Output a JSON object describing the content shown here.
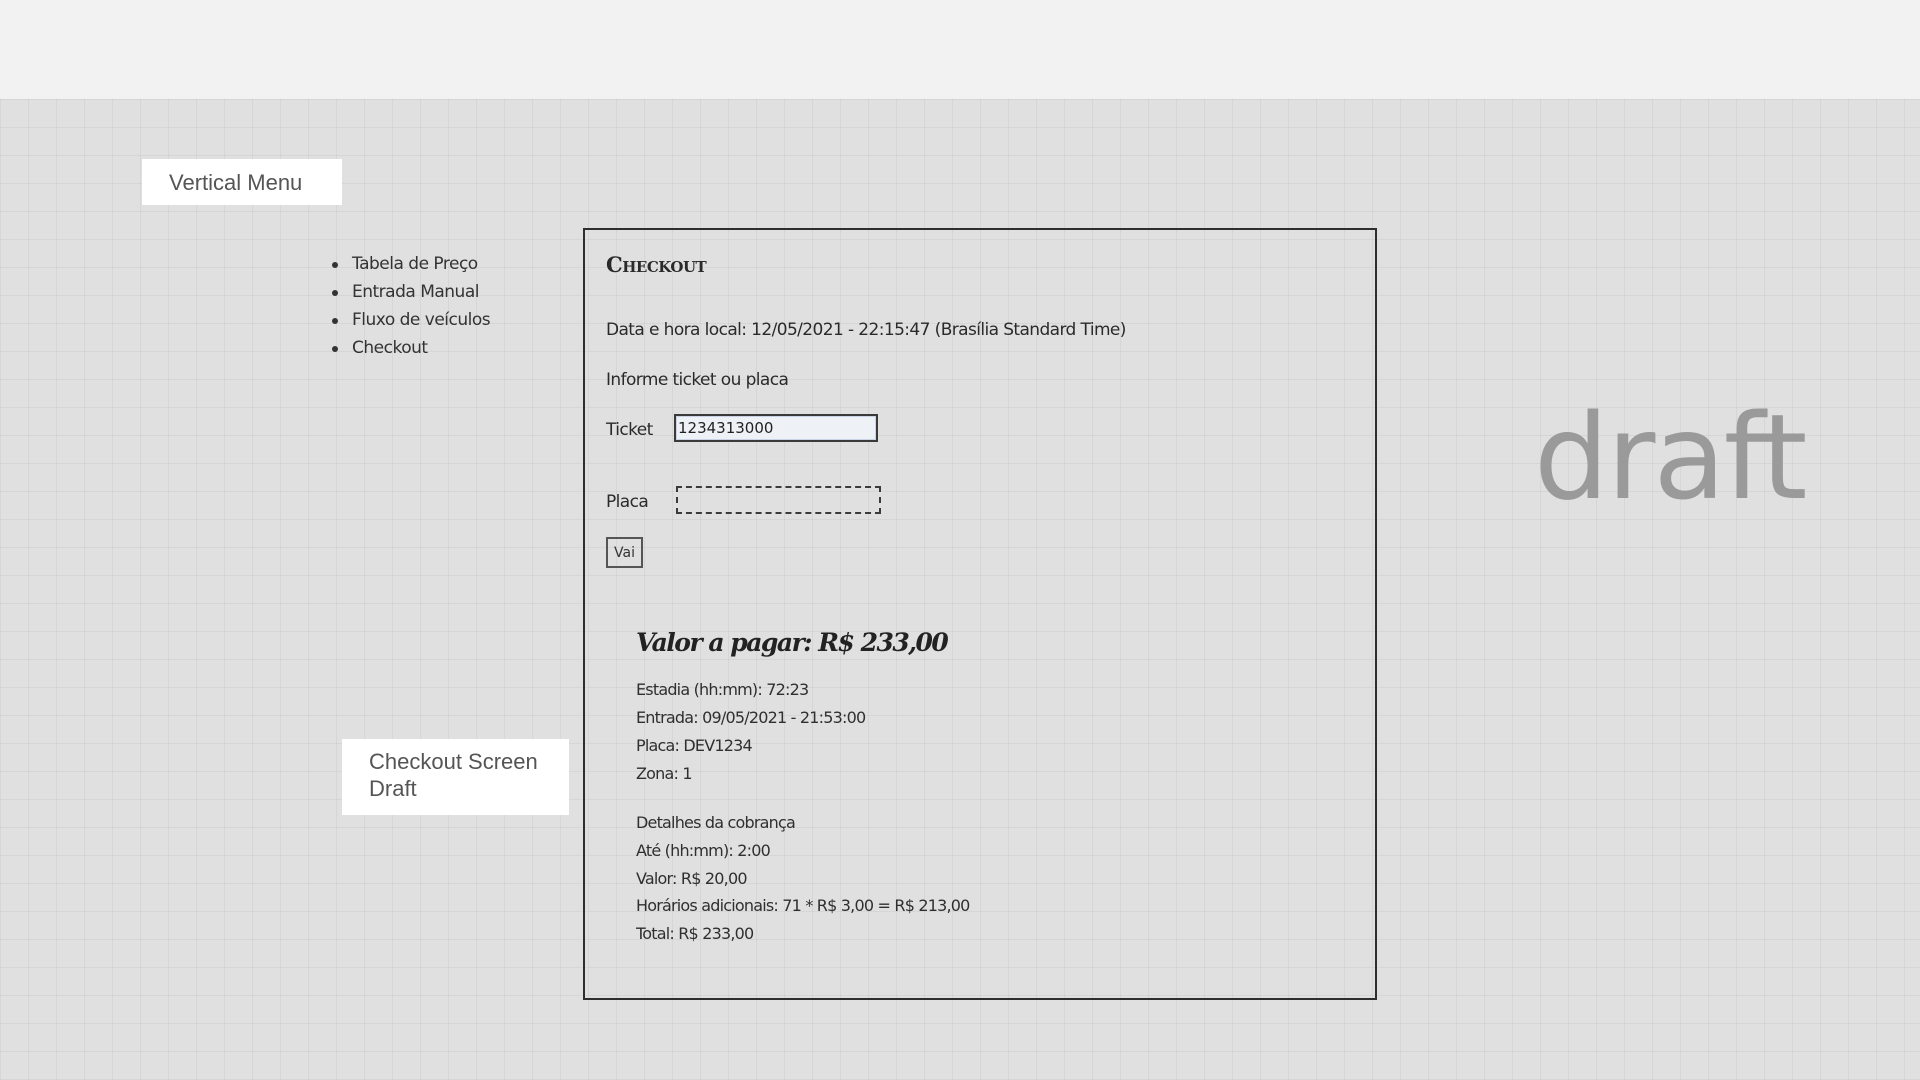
{
  "annotations": {
    "vertical_menu": "Vertical Menu",
    "checkout_draft": "Checkout Screen Draft"
  },
  "menu": {
    "items": [
      {
        "label": "Tabela de Preço"
      },
      {
        "label": "Entrada Manual"
      },
      {
        "label": "Fluxo de veículos"
      },
      {
        "label": "Checkout"
      }
    ]
  },
  "checkout": {
    "title": "Checkout",
    "datetime": "Data e hora local: 12/05/2021 - 22:15:47 (Brasília Standard Time)",
    "instruction": "Informe ticket ou placa",
    "ticket_label": "Ticket",
    "ticket_value": "1234313000",
    "placa_label": "Placa",
    "placa_value": "",
    "go_button": "Vai",
    "amount_due": "Valor a pagar: R$ 233,00",
    "stay": "Estadia (hh:mm): 72:23",
    "entry": "Entrada: 09/05/2021 - 21:53:00",
    "plate": "Placa: DEV1234",
    "zone": "Zona: 1",
    "charge_details_title": "Detalhes da cobrança",
    "until": "Até (hh:mm): 2:00",
    "value": "Valor: R$ 20,00",
    "additional_hours": "Horários adicionais: 71 * R$ 3,00 = R$ 213,00",
    "total": "Total: R$ 233,00"
  },
  "watermark": "draft"
}
